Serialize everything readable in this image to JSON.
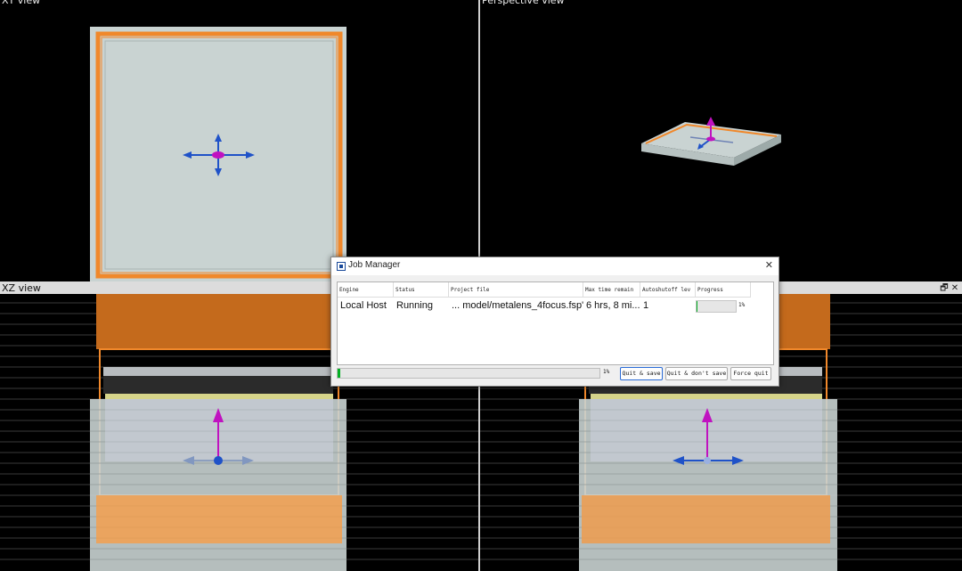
{
  "views": {
    "top_left_title": "XY view",
    "top_right_title": "Perspective view",
    "bottom_left_title": "XZ view",
    "bottom_right_title": "",
    "restore_icon": "restore-icon",
    "close_glyph": "✕",
    "restore_glyph": "🗗"
  },
  "colors": {
    "background": "#000000",
    "substrate": "#c9d3d2",
    "orange_frame": "#f0882b",
    "arrow_blue": "#1f52c8",
    "arrow_magenta": "#c012c0",
    "progress_green": "#06b025"
  },
  "dialog": {
    "title": "Job Manager",
    "close_glyph": "✕",
    "columns": [
      "Engine",
      "Status",
      "Project file",
      "Max time remain",
      "Autoshutoff lev",
      "Progress"
    ],
    "rows": [
      {
        "engine": "Local Host",
        "status": "Running",
        "project_file": "... model/metalens_4focus.fsp\"",
        "max_time": "6 hrs, 8 mi...",
        "autoshutoff": "1",
        "progress_pct": "1%",
        "progress_value": 0.01
      }
    ],
    "overall_progress_pct": "1%",
    "overall_progress_value": 0.01,
    "buttons": {
      "quit_save": "Quit & save",
      "quit_dont_save": "Quit & don't save",
      "force_quit": "Force quit"
    }
  }
}
